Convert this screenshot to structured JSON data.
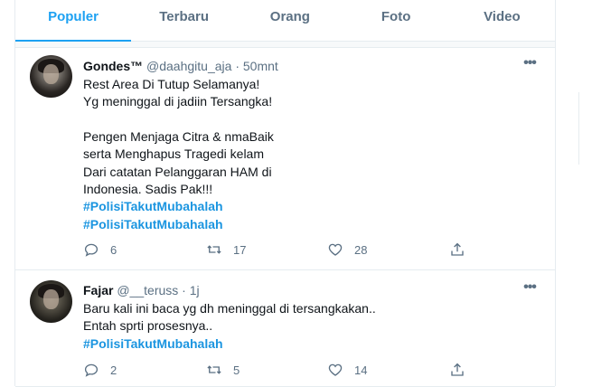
{
  "tabs": [
    {
      "label": "Populer",
      "active": true
    },
    {
      "label": "Terbaru"
    },
    {
      "label": "Orang"
    },
    {
      "label": "Foto"
    },
    {
      "label": "Video"
    }
  ],
  "tweets": [
    {
      "name": "Gondes™",
      "handle": "@daahgitu_aja",
      "separator": "·",
      "time": "50mnt",
      "lines": [
        "Rest Area Di Tutup Selamanya!",
        "Yg meninggal di jadiin Tersangka!",
        "",
        "Pengen Menjaga Citra & nmaBaik",
        "serta Menghapus Tragedi kelam",
        "Dari catatan Pelanggaran HAM di",
        "Indonesia. Sadis Pak!!!"
      ],
      "hashtags": [
        "#PolisiTakutMubahalah",
        "#PolisiTakutMubahalah"
      ],
      "replies": "6",
      "retweets": "17",
      "likes": "28"
    },
    {
      "name": "Fajar",
      "handle": "@__teruss",
      "separator": "·",
      "time": "1j",
      "lines": [
        "Baru kali ini baca yg dh meninggal di tersangkakan..",
        "Entah sprti prosesnya.."
      ],
      "hashtags": [
        "#PolisiTakutMubahalah"
      ],
      "replies": "2",
      "retweets": "5",
      "likes": "14"
    }
  ],
  "more_glyph": "•••",
  "colors": {
    "accent": "#1da1f2",
    "hashtag": "#1b95e0",
    "muted": "#5b7083",
    "border": "#e6ecf0"
  },
  "icons": [
    "more-icon",
    "reply-icon",
    "retweet-icon",
    "like-icon",
    "share-icon"
  ]
}
